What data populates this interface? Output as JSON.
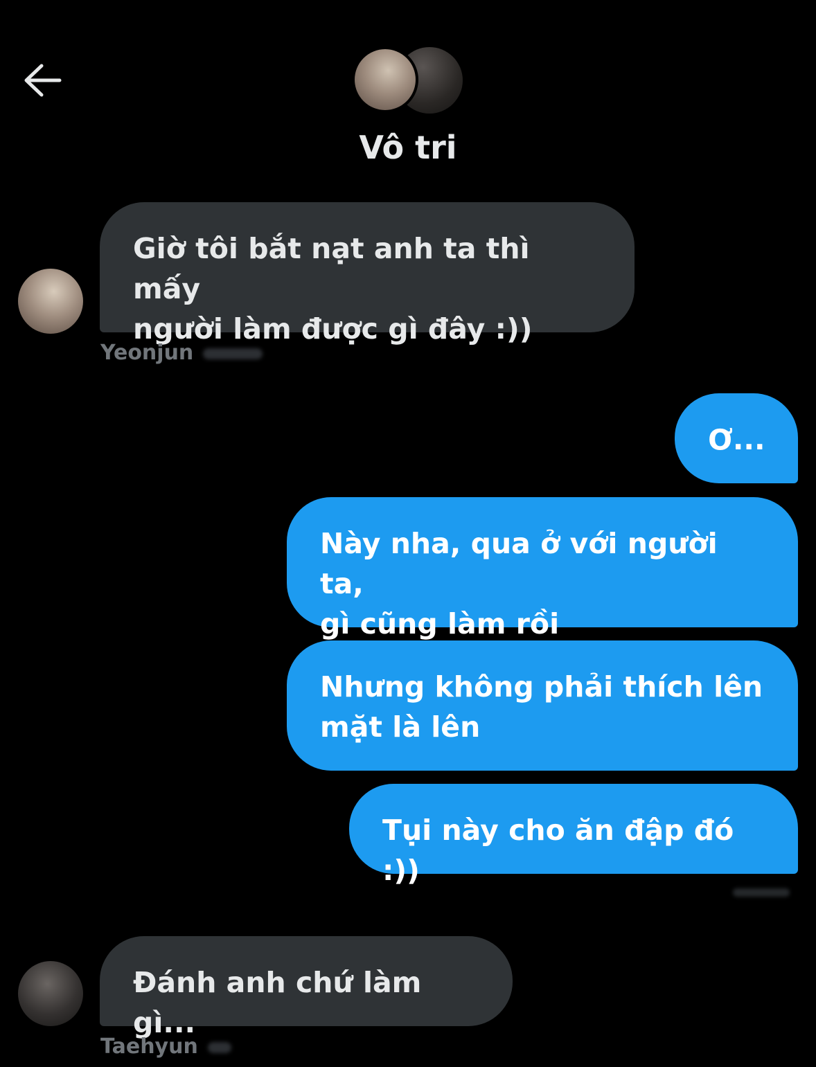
{
  "header": {
    "back_icon": "arrow-left-icon",
    "title": "Vô tri"
  },
  "colors": {
    "background": "#000000",
    "incoming_bubble": "#2f3336",
    "outgoing_bubble": "#1d9bf0",
    "text_primary": "#e7e9ea",
    "text_secondary": "#71767b"
  },
  "messages": [
    {
      "direction": "incoming",
      "sender": "Yeonjun",
      "text": "Giờ tôi bắt nạt anh ta thì mấy\nngười làm được gì đây :))"
    },
    {
      "direction": "outgoing",
      "text": "Ơ..."
    },
    {
      "direction": "outgoing",
      "text": "Này nha, qua ở với người ta,\ngì cũng làm rồi"
    },
    {
      "direction": "outgoing",
      "text": "Nhưng không phải thích lên\nmặt là lên"
    },
    {
      "direction": "outgoing",
      "text": "Tụi này cho ăn đập đó :))"
    },
    {
      "direction": "incoming",
      "sender": "Taehyun",
      "text": "Đánh anh chứ làm gì..."
    }
  ]
}
